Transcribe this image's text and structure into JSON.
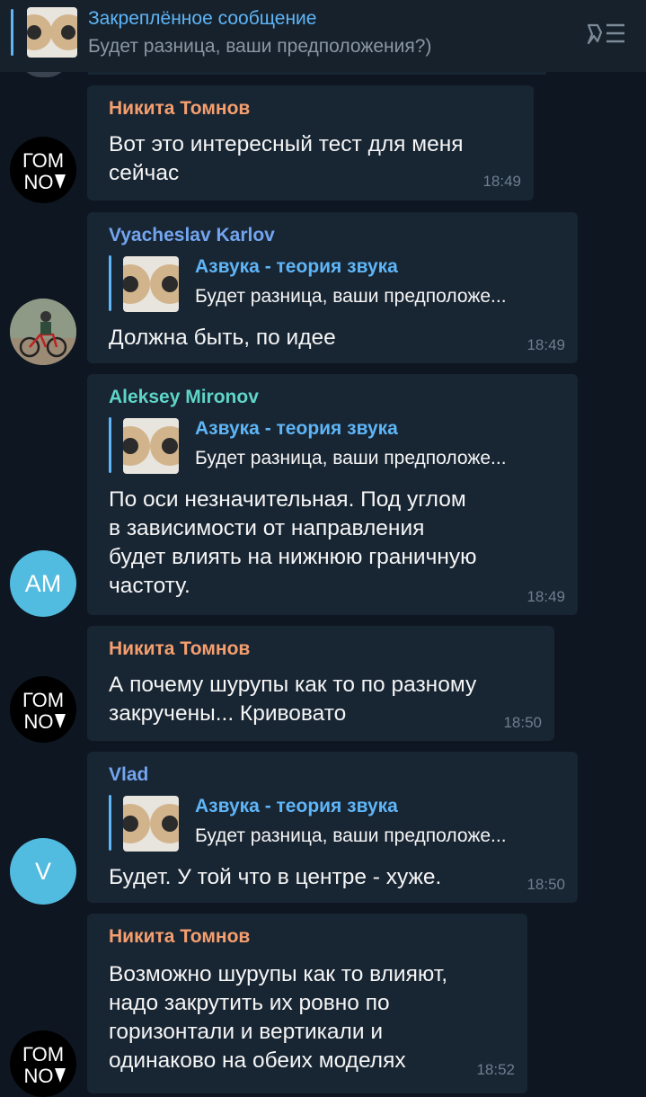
{
  "pinned": {
    "title": "Закреплённое сообщение",
    "text": "Будет разница, ваши предположения?)",
    "list_icon": "pinned-list-icon"
  },
  "messages": [
    {
      "author": "Никита Томнов",
      "author_color": "#f59f6f",
      "lines": [
        "Вот это интересный тест для меня",
        "сейчас"
      ],
      "time": "18:49",
      "avatar": "logo"
    },
    {
      "author": "Vyacheslav Karlov",
      "author_color": "#73a5ee",
      "reply_title": "Азвука - теория звука",
      "reply_text": "Будет разница, ваши предположе...",
      "lines": [
        "Должна быть, по идее"
      ],
      "time": "18:49",
      "avatar": "photo"
    },
    {
      "author": "Aleksey Mironov",
      "author_color": "#5fd5c8",
      "reply_title": "Азвука - теория звука",
      "reply_text": "Будет разница, ваши предположе...",
      "lines": [
        "По оси незначительная. Под углом",
        "в зависимости от направления",
        "будет влиять на нижнюю граничную",
        "частоту."
      ],
      "time": "18:49",
      "avatar": "letters",
      "avatar_text": "AM"
    },
    {
      "author": "Никита Томнов",
      "author_color": "#f59f6f",
      "lines": [
        "А почему шурупы как то по разному",
        "закручены... Кривовато"
      ],
      "time": "18:50",
      "avatar": "logo"
    },
    {
      "author": "Vlad",
      "author_color": "#73a5ee",
      "reply_title": "Азвука - теория звука",
      "reply_text": "Будет разница, ваши предположе...",
      "lines": [
        "Будет. У той что в центре - хуже."
      ],
      "time": "18:50",
      "avatar": "letters",
      "avatar_text": "V"
    },
    {
      "author": "Никита Томнов",
      "author_color": "#f59f6f",
      "lines": [
        "Возможно шурупы как то влияют,",
        "надо закрутить их ровно по",
        "горизонтали и вертикали и",
        "одинаково на обеих моделях"
      ],
      "time": "18:52",
      "avatar": "logo"
    }
  ],
  "logo": {
    "line1": "ГОМ",
    "line2": "NO"
  }
}
